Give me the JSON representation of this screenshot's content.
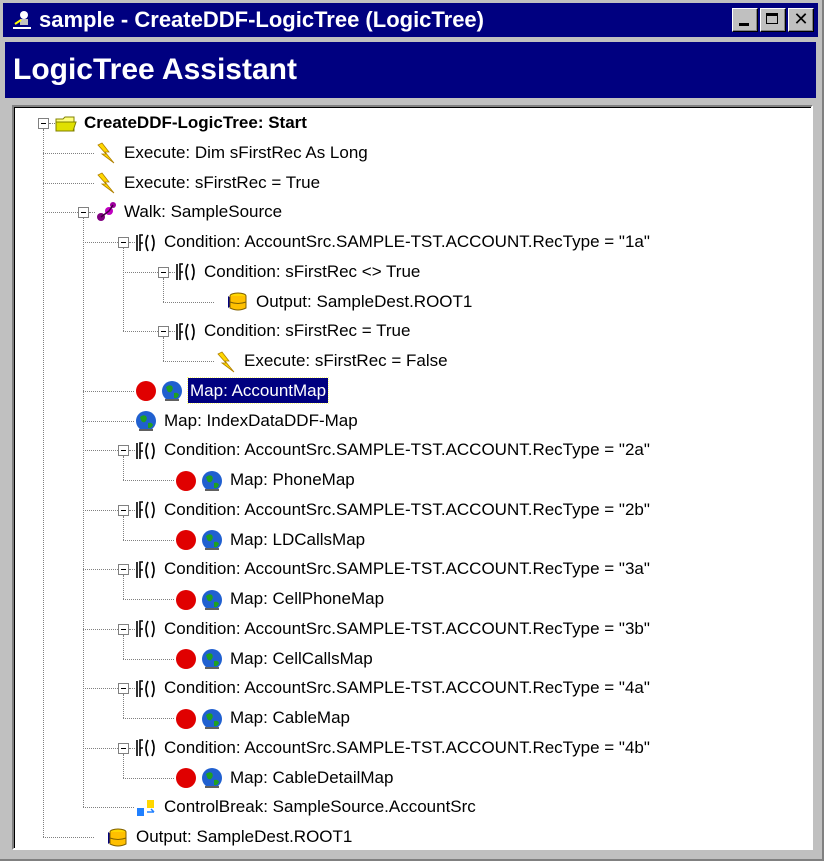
{
  "window": {
    "title": "sample - CreateDDF-LogicTree (LogicTree)",
    "minimize_glyph": "",
    "maximize_glyph": "",
    "close_glyph": "✕"
  },
  "assistant": {
    "title": "LogicTree Assistant"
  },
  "colors": {
    "titlebar": "#000080",
    "selection": "#000080",
    "window": "#c0c0c0"
  },
  "tree": [
    {
      "label": "CreateDDF-LogicTree: Start",
      "icons": [
        "folder-icon"
      ],
      "expanded": true,
      "bold": true
    },
    {
      "label": "Execute: Dim sFirstRec As Long",
      "icons": [
        "lightning-icon"
      ]
    },
    {
      "label": "Execute: sFirstRec = True",
      "icons": [
        "lightning-icon"
      ]
    },
    {
      "label": "Walk: SampleSource",
      "icons": [
        "walk-icon"
      ],
      "expanded": true
    },
    {
      "label": "Condition: AccountSrc.SAMPLE-TST.ACCOUNT.RecType = \"1a\"",
      "icons": [
        "if-icon"
      ],
      "expanded": true
    },
    {
      "label": "Condition: sFirstRec <> True",
      "icons": [
        "if-icon"
      ],
      "expanded": true
    },
    {
      "label": "Output: SampleDest.ROOT1",
      "icons": [
        "output-arrow-icon",
        "database-icon"
      ]
    },
    {
      "label": "Condition: sFirstRec = True",
      "icons": [
        "if-icon"
      ],
      "expanded": true
    },
    {
      "label": "Execute: sFirstRec = False",
      "icons": [
        "lightning-icon"
      ]
    },
    {
      "label": "Map: AccountMap",
      "icons": [
        "breakpoint-icon",
        "globe-icon"
      ],
      "selected": true
    },
    {
      "label": "Map: IndexDataDDF-Map",
      "icons": [
        "globe-icon"
      ]
    },
    {
      "label": "Condition: AccountSrc.SAMPLE-TST.ACCOUNT.RecType = \"2a\"",
      "icons": [
        "if-icon"
      ],
      "expanded": true
    },
    {
      "label": "Map: PhoneMap",
      "icons": [
        "breakpoint-icon",
        "globe-icon"
      ]
    },
    {
      "label": "Condition: AccountSrc.SAMPLE-TST.ACCOUNT.RecType = \"2b\"",
      "icons": [
        "if-icon"
      ],
      "expanded": true
    },
    {
      "label": "Map: LDCallsMap",
      "icons": [
        "breakpoint-icon",
        "globe-icon"
      ]
    },
    {
      "label": "Condition: AccountSrc.SAMPLE-TST.ACCOUNT.RecType = \"3a\"",
      "icons": [
        "if-icon"
      ],
      "expanded": true
    },
    {
      "label": "Map: CellPhoneMap",
      "icons": [
        "breakpoint-icon",
        "globe-icon"
      ]
    },
    {
      "label": "Condition: AccountSrc.SAMPLE-TST.ACCOUNT.RecType = \"3b\"",
      "icons": [
        "if-icon"
      ],
      "expanded": true
    },
    {
      "label": "Map: CellCallsMap",
      "icons": [
        "breakpoint-icon",
        "globe-icon"
      ]
    },
    {
      "label": "Condition: AccountSrc.SAMPLE-TST.ACCOUNT.RecType = \"4a\"",
      "icons": [
        "if-icon"
      ],
      "expanded": true
    },
    {
      "label": "Map: CableMap",
      "icons": [
        "breakpoint-icon",
        "globe-icon"
      ]
    },
    {
      "label": "Condition: AccountSrc.SAMPLE-TST.ACCOUNT.RecType = \"4b\"",
      "icons": [
        "if-icon"
      ],
      "expanded": true
    },
    {
      "label": "Map: CableDetailMap",
      "icons": [
        "breakpoint-icon",
        "globe-icon"
      ]
    },
    {
      "label": "ControlBreak: SampleSource.AccountSrc",
      "icons": [
        "controlbreak-icon"
      ]
    },
    {
      "label": "Output: SampleDest.ROOT1",
      "icons": [
        "output-arrow-icon",
        "database-icon"
      ]
    }
  ]
}
